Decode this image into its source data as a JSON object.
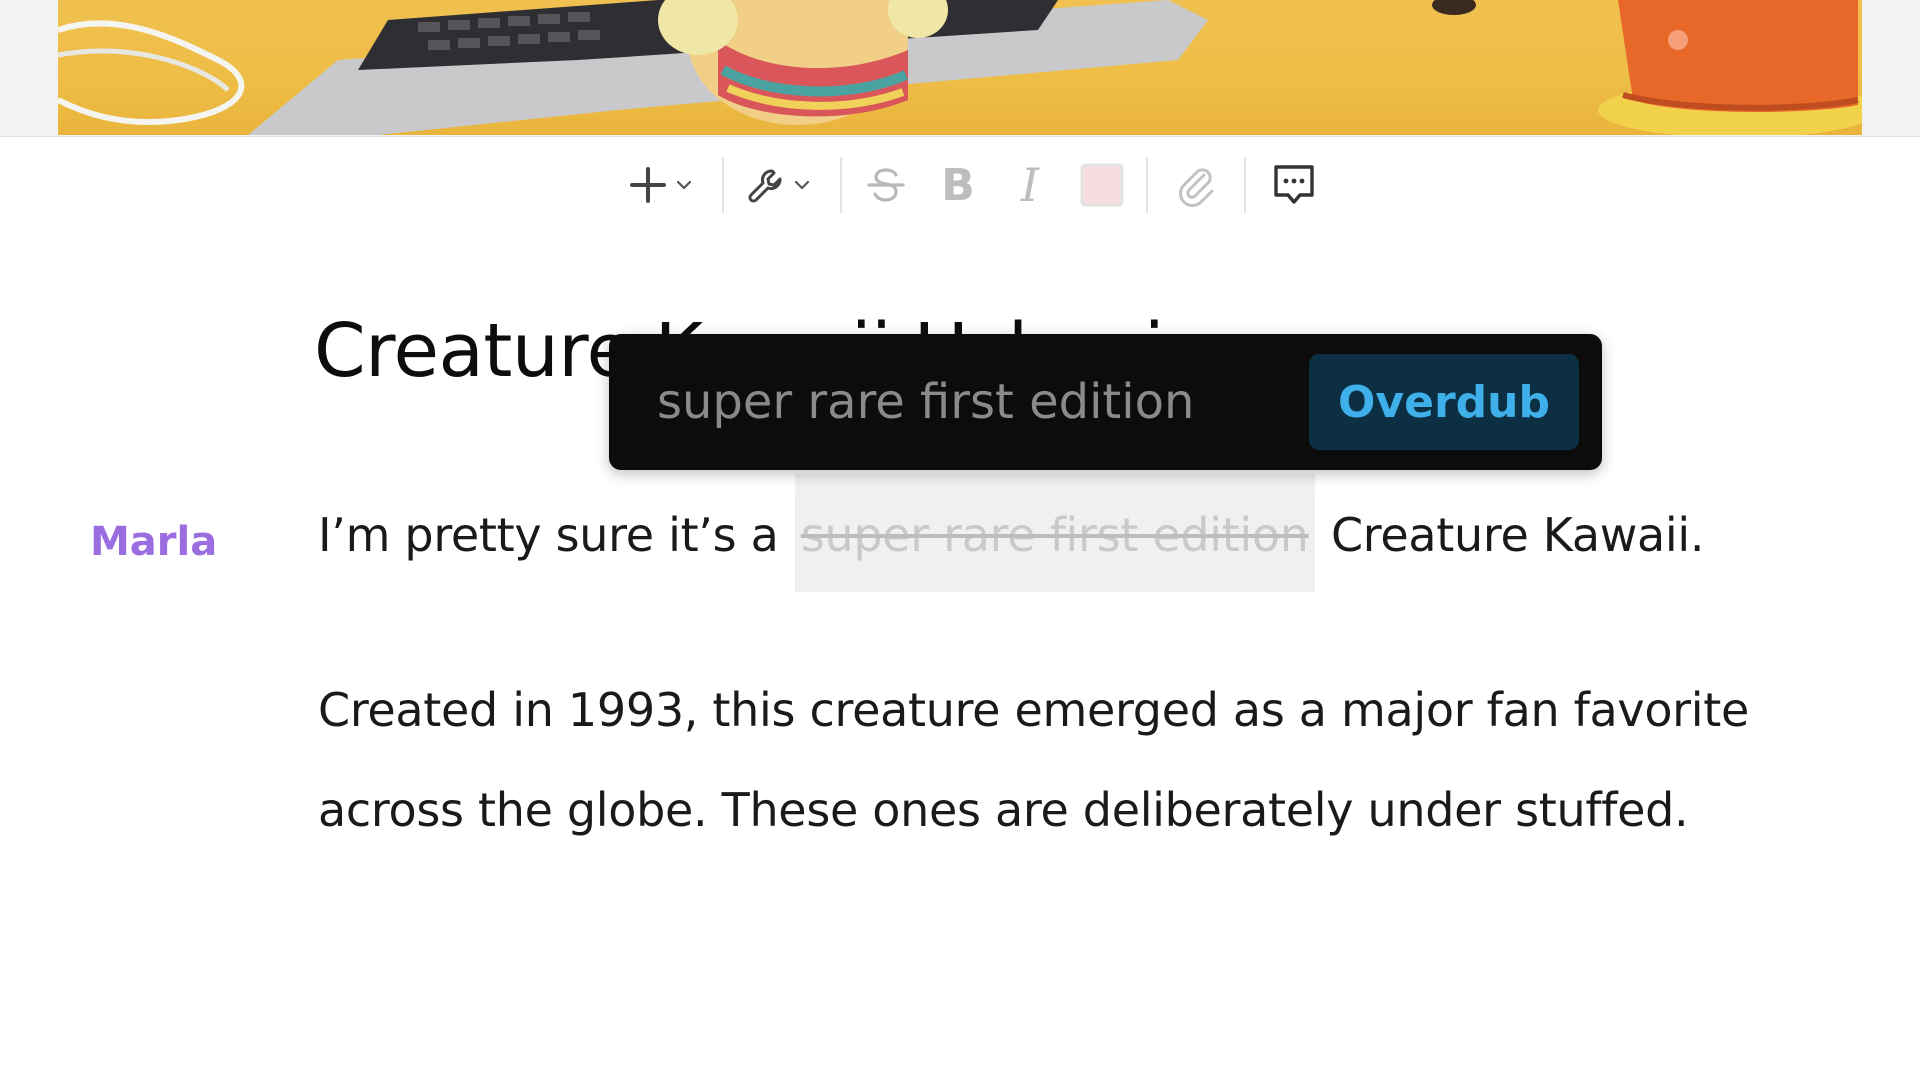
{
  "toolbar": {
    "insert_icon": "plus-icon",
    "tools_icon": "wrench-icon",
    "strikethrough_icon": "strikethrough-icon",
    "bold_label": "B",
    "italic_label": "I",
    "highlight_icon": "highlight-swatch-icon",
    "link_icon": "paperclip-icon",
    "comment_icon": "comment-icon"
  },
  "document": {
    "title": "Creature Kawaii Uchooi"
  },
  "transcript": {
    "speaker": "Marla",
    "para1_before": "I’m pretty sure it’s a ",
    "para1_struck": "super rare first edition",
    "para1_after": " Creature Kawaii.",
    "para2_line1": "Created in 1993, this creature emerged as a major fan favorite",
    "para2_line2": "across the globe. These ones are deliberately under stuffed."
  },
  "overdub": {
    "input_value": "super rare first edition",
    "button_label": "Overdub"
  },
  "colors": {
    "speaker": "#9a6ee0",
    "popup_bg": "#0c0c0c",
    "overdub_button_bg": "#0c2f44",
    "overdub_button_text": "#3fb0ea"
  }
}
